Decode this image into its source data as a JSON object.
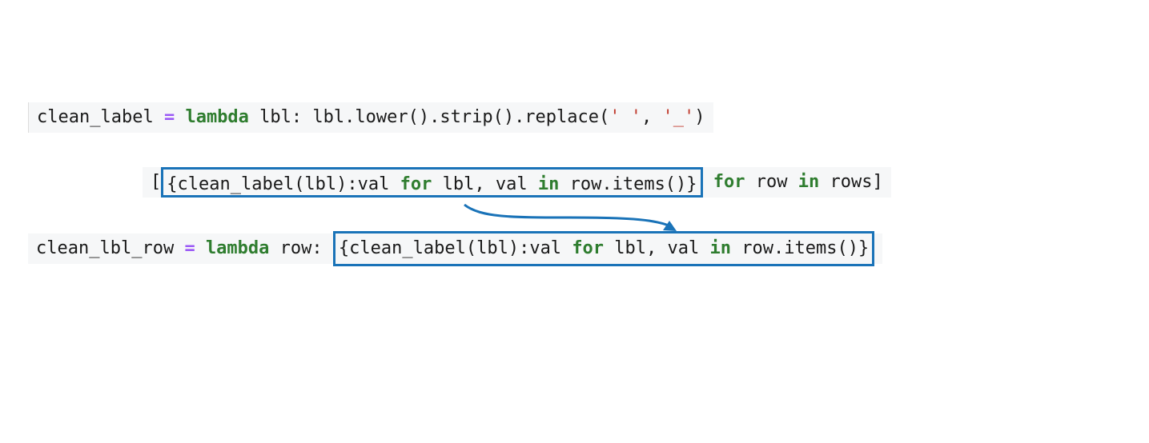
{
  "line1": {
    "t1": "clean_label ",
    "op": "=",
    "t2": " ",
    "kw": "lambda",
    "t3": " lbl: lbl.lower().strip().replace(",
    "s1": "' '",
    "t4": ", ",
    "s2": "'_'",
    "t5": ")"
  },
  "line2": {
    "open": "[",
    "h1": "{clean_label(lbl):val ",
    "hkw1": "for",
    "h2": " lbl, val ",
    "hkw2": "in",
    "h3": " row.items()}",
    "t1": " ",
    "kw1": "for",
    "t2": " row ",
    "kw2": "in",
    "t3": " rows]"
  },
  "line3": {
    "t1": "clean_lbl_row ",
    "op": "=",
    "t2": " ",
    "kw": "lambda",
    "t3": " row: ",
    "h1": "{clean_label(lbl):val ",
    "hkw1": "for",
    "h2": " lbl, val ",
    "hkw2": "in",
    "h3": " row.items()}"
  },
  "colors": {
    "highlight_border": "#1a73b8",
    "keyword": "#2f7d2f",
    "operator": "#9b59f6",
    "string": "#c0392b"
  }
}
